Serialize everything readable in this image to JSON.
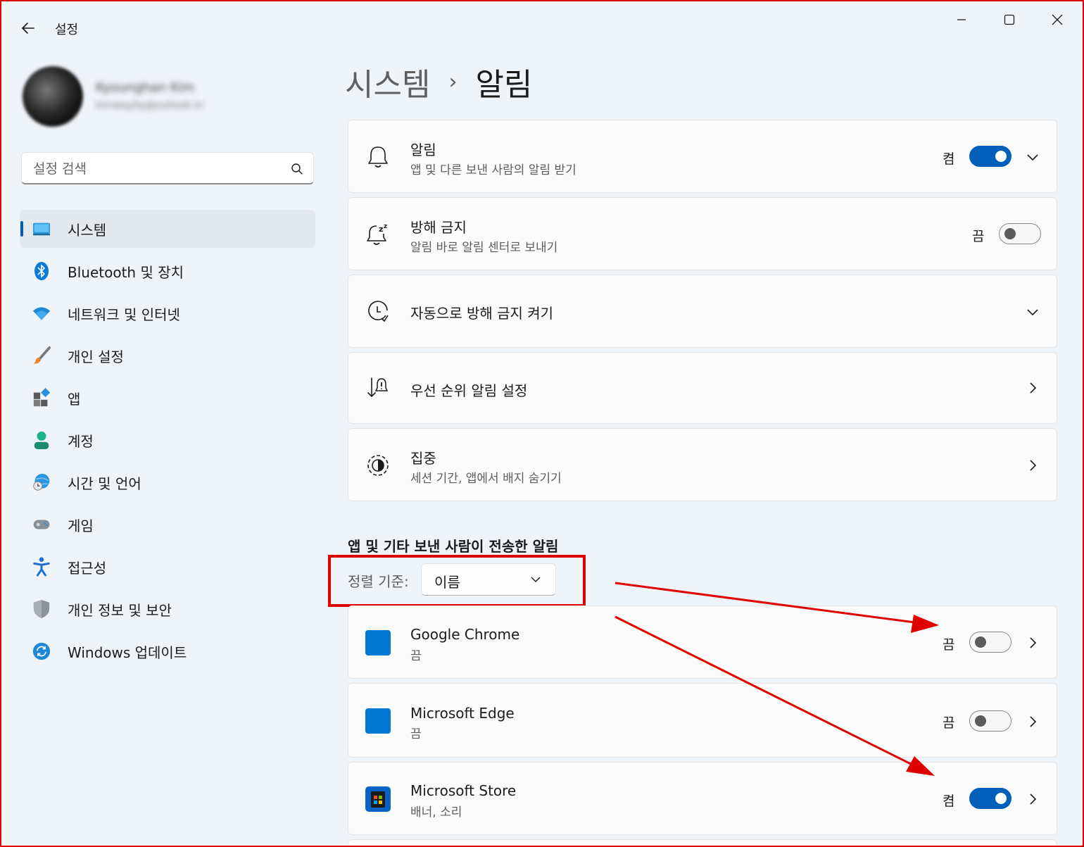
{
  "window": {
    "title": "설정",
    "back_icon": "back-arrow-icon",
    "controls": [
      "minimize-icon",
      "maximize-icon",
      "close-icon"
    ]
  },
  "profile": {
    "name": "Kyounghan Kim",
    "email": "kimwaylly@outlook.kr"
  },
  "search": {
    "placeholder": "설정 검색",
    "value": ""
  },
  "sidebar": {
    "items": [
      {
        "label": "시스템",
        "icon": "system-display-icon",
        "active": true
      },
      {
        "label": "Bluetooth 및 장치",
        "icon": "bluetooth-icon"
      },
      {
        "label": "네트워크 및 인터넷",
        "icon": "wifi-icon"
      },
      {
        "label": "개인 설정",
        "icon": "paintbrush-icon"
      },
      {
        "label": "앱",
        "icon": "apps-icon"
      },
      {
        "label": "계정",
        "icon": "account-icon"
      },
      {
        "label": "시간 및 언어",
        "icon": "globe-clock-icon"
      },
      {
        "label": "게임",
        "icon": "gamepad-icon"
      },
      {
        "label": "접근성",
        "icon": "accessibility-icon"
      },
      {
        "label": "개인 정보 및 보안",
        "icon": "shield-icon"
      },
      {
        "label": "Windows 업데이트",
        "icon": "update-icon"
      }
    ]
  },
  "breadcrumb": {
    "parent": "시스템",
    "separator": "›",
    "current": "알림"
  },
  "settings": [
    {
      "title": "알림",
      "subtitle": "앱 및 다른 보낸 사람의 알림 받기",
      "icon": "bell-icon",
      "toggle_state": "켬",
      "toggle_on": true,
      "expand": "chevron-down"
    },
    {
      "title": "방해 금지",
      "subtitle": "알림 바로 알림 센터로 보내기",
      "icon": "bell-snooze-icon",
      "toggle_state": "끔",
      "toggle_on": false
    },
    {
      "title": "자동으로 방해 금지 켜기",
      "icon": "clock-icon",
      "expand": "chevron-down"
    },
    {
      "title": "우선 순위 알림 설정",
      "icon": "priority-icon",
      "expand": "chevron-right"
    },
    {
      "title": "집중",
      "subtitle": "세션 기간, 앱에서 배지 숨기기",
      "icon": "focus-icon",
      "expand": "chevron-right"
    }
  ],
  "apps_section": {
    "title": "앱 및 기타 보낸 사람이 전송한 알림",
    "sort_label": "정렬 기준:",
    "sort_value": "이름",
    "apps": [
      {
        "name": "Google Chrome",
        "subtitle": "끔",
        "toggle_state": "끔",
        "toggle_on": false,
        "icon": "chrome-app-icon"
      },
      {
        "name": "Microsoft Edge",
        "subtitle": "끔",
        "toggle_state": "끔",
        "toggle_on": false,
        "icon": "edge-app-icon"
      },
      {
        "name": "Microsoft Store",
        "subtitle": "배너, 소리",
        "toggle_state": "켬",
        "toggle_on": true,
        "icon": "store-app-icon"
      }
    ]
  },
  "colors": {
    "accent": "#005fb8",
    "annotation": "#e00000",
    "background": "#eff4f9",
    "card": "#fbfbfb"
  }
}
